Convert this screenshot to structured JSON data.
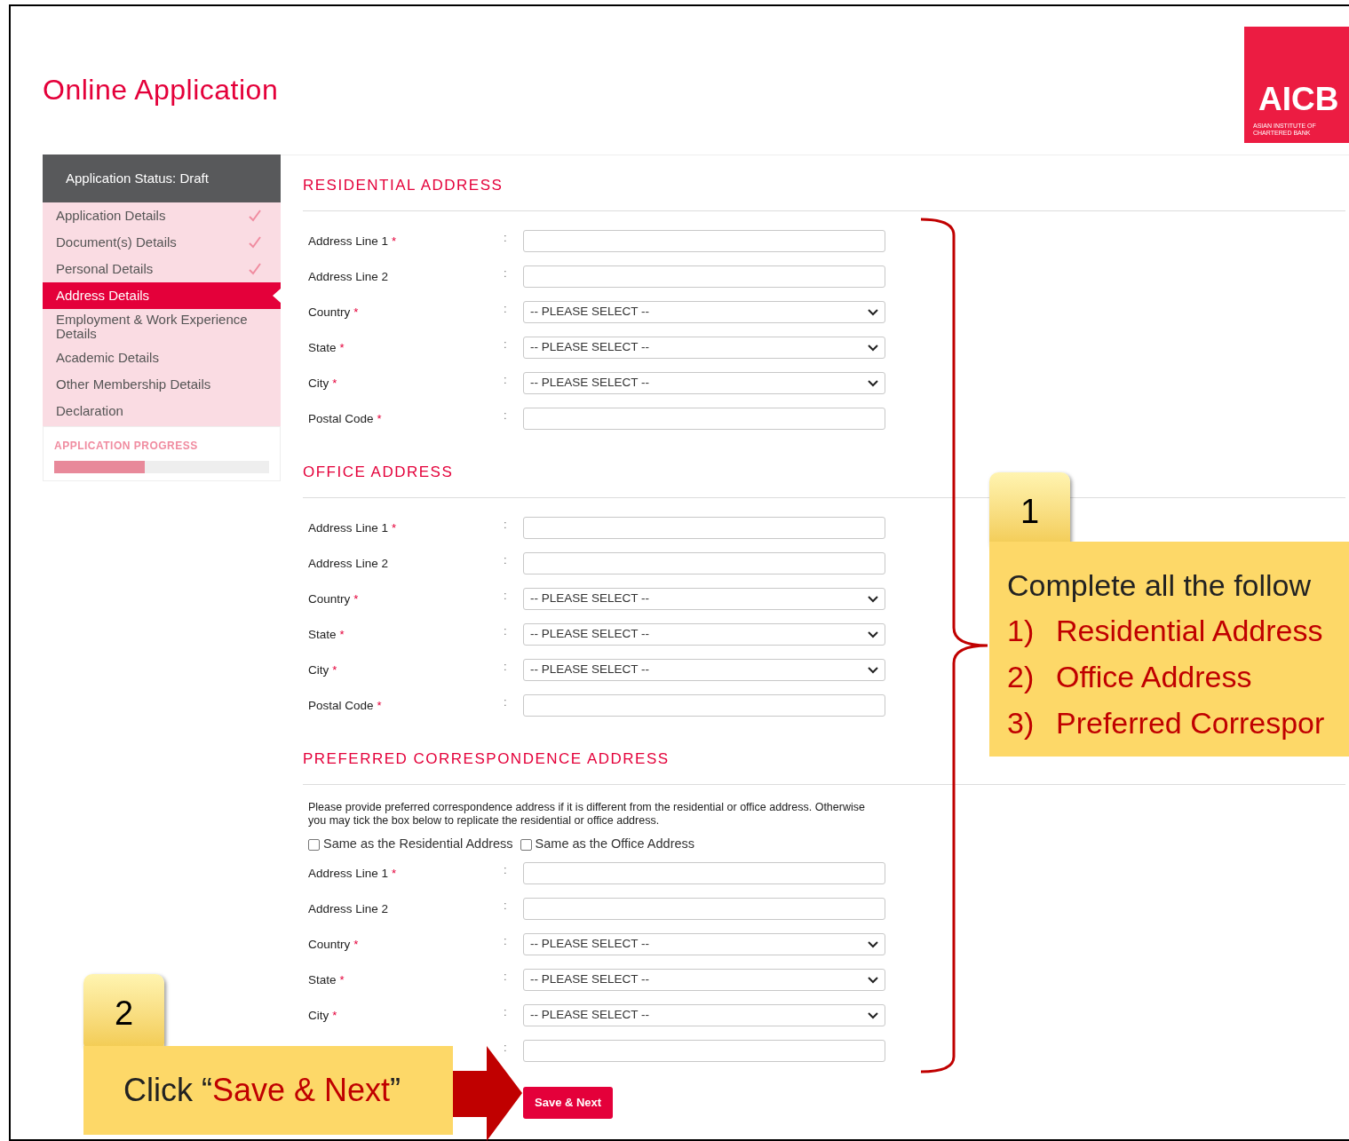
{
  "page_title": "Online Application",
  "logo": {
    "text": "AICB",
    "subtitle": "ASIAN INSTITUTE OF CHARTERED BANK"
  },
  "sidebar": {
    "status": "Application Status: Draft",
    "items": [
      {
        "label": "Application Details",
        "selected": false,
        "completed": true
      },
      {
        "label": "Document(s) Details",
        "selected": false,
        "completed": true
      },
      {
        "label": "Personal Details",
        "selected": false,
        "completed": true
      },
      {
        "label": "Address Details",
        "selected": true,
        "completed": false
      },
      {
        "label": "Employment & Work Experience Details",
        "selected": false,
        "completed": false
      },
      {
        "label": "Academic Details",
        "selected": false,
        "completed": false
      },
      {
        "label": "Other Membership Details",
        "selected": false,
        "completed": false
      },
      {
        "label": "Declaration",
        "selected": false,
        "completed": false
      }
    ],
    "progress": {
      "label": "APPLICATION PROGRESS",
      "level": 0.42
    }
  },
  "sections": [
    {
      "title": "RESIDENTIAL ADDRESS",
      "fields": [
        {
          "label": "Address Line 1",
          "required": true,
          "kind": "text"
        },
        {
          "label": "Address Line 2",
          "required": false,
          "kind": "text"
        },
        {
          "label": "Country",
          "required": true,
          "kind": "select",
          "value": "-- PLEASE SELECT --"
        },
        {
          "label": "State",
          "required": true,
          "kind": "select",
          "value": "-- PLEASE SELECT --"
        },
        {
          "label": "City",
          "required": true,
          "kind": "select",
          "value": "-- PLEASE SELECT --"
        },
        {
          "label": "Postal Code",
          "required": true,
          "kind": "text"
        }
      ]
    },
    {
      "title": "OFFICE ADDRESS",
      "fields": [
        {
          "label": "Address Line 1",
          "required": true,
          "kind": "text"
        },
        {
          "label": "Address Line 2",
          "required": false,
          "kind": "text"
        },
        {
          "label": "Country",
          "required": true,
          "kind": "select",
          "value": "-- PLEASE SELECT --"
        },
        {
          "label": "State",
          "required": true,
          "kind": "select",
          "value": "-- PLEASE SELECT --"
        },
        {
          "label": "City",
          "required": true,
          "kind": "select",
          "value": "-- PLEASE SELECT --"
        },
        {
          "label": "Postal Code",
          "required": true,
          "kind": "text"
        }
      ]
    },
    {
      "title": "PREFERRED CORRESPONDENCE ADDRESS",
      "note": "Please provide preferred correspondence address if it is different from the residential or office address. Otherwise you may tick the box below to replicate the residential or office address.",
      "options": [
        {
          "label": "Same as the Residential Address",
          "checked": false
        },
        {
          "label": "Same as the Office Address",
          "checked": false
        }
      ],
      "fields": [
        {
          "label": "Address Line 1",
          "required": true,
          "kind": "text"
        },
        {
          "label": "Address Line 2",
          "required": false,
          "kind": "text"
        },
        {
          "label": "Country",
          "required": true,
          "kind": "select",
          "value": "-- PLEASE SELECT --"
        },
        {
          "label": "State",
          "required": true,
          "kind": "select",
          "value": "-- PLEASE SELECT --"
        },
        {
          "label": "City",
          "required": true,
          "kind": "select",
          "value": "-- PLEASE SELECT --"
        },
        {
          "kind": "text"
        }
      ]
    }
  ],
  "required_marker": "*",
  "separator": ":",
  "save_button": "Save & Next",
  "callouts": [
    {
      "number": "1",
      "intro": "Complete all the follow",
      "items": [
        {
          "number": "1)",
          "text": "Residential Address"
        },
        {
          "number": "2)",
          "text": "Office Address"
        },
        {
          "number": "3)",
          "text": "Preferred Correspor"
        }
      ]
    },
    {
      "number": "2",
      "instruction": [
        {
          "text": "Click “",
          "highlight": false
        },
        {
          "text": "Save & Next",
          "highlight": true
        },
        {
          "text": "”",
          "highlight": false
        }
      ]
    }
  ]
}
